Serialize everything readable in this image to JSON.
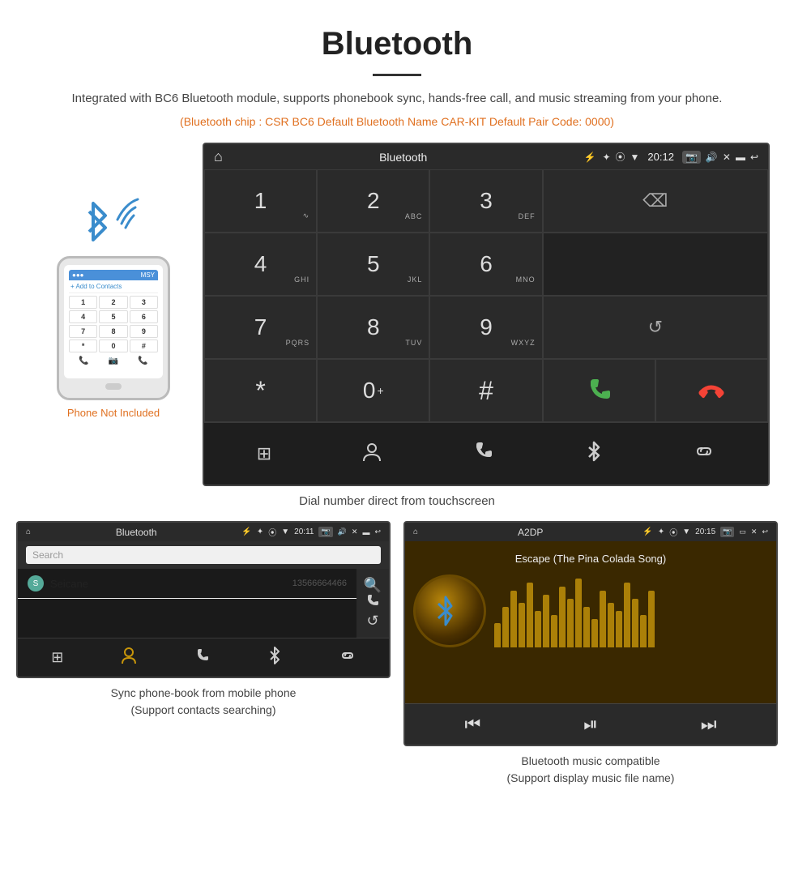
{
  "page": {
    "title": "Bluetooth",
    "subtitle": "Integrated with BC6 Bluetooth module, supports phonebook sync, hands-free call, and music streaming from your phone.",
    "specs": "(Bluetooth chip : CSR BC6    Default Bluetooth Name CAR-KIT    Default Pair Code: 0000)"
  },
  "main_screen": {
    "status_bar": {
      "home_icon": "⌂",
      "title": "Bluetooth",
      "usb_icon": "⚡",
      "bt_icon": "✦",
      "location_icon": "◉",
      "signal_icon": "▼",
      "time": "20:12",
      "camera_icon": "📷",
      "volume_icon": "🔊",
      "close_icon": "✕",
      "window_icon": "▬",
      "back_icon": "↩"
    },
    "dialpad": [
      {
        "key": "1",
        "sub": "∿",
        "row": 1,
        "col": 1
      },
      {
        "key": "2",
        "sub": "ABC",
        "row": 1,
        "col": 2
      },
      {
        "key": "3",
        "sub": "DEF",
        "row": 1,
        "col": 3
      },
      {
        "key": "⌫",
        "type": "backspace",
        "row": 1,
        "col": "4-5"
      },
      {
        "key": "4",
        "sub": "GHI",
        "row": 2,
        "col": 1
      },
      {
        "key": "5",
        "sub": "JKL",
        "row": 2,
        "col": 2
      },
      {
        "key": "6",
        "sub": "MNO",
        "row": 2,
        "col": 3
      },
      {
        "key": "",
        "type": "empty",
        "row": 2,
        "col": "4-5"
      },
      {
        "key": "7",
        "sub": "PQRS",
        "row": 3,
        "col": 1
      },
      {
        "key": "8",
        "sub": "TUV",
        "row": 3,
        "col": 2
      },
      {
        "key": "9",
        "sub": "WXYZ",
        "row": 3,
        "col": 3
      },
      {
        "key": "↺",
        "type": "reload",
        "row": 3,
        "col": "4-5"
      },
      {
        "key": "*",
        "row": 4,
        "col": 1
      },
      {
        "key": "0",
        "sub": "+",
        "row": 4,
        "col": 2
      },
      {
        "key": "#",
        "row": 4,
        "col": 3
      },
      {
        "key": "✆",
        "type": "call",
        "row": 4,
        "col": 4
      },
      {
        "key": "✆",
        "type": "hang",
        "row": 4,
        "col": 5
      }
    ],
    "action_bar": [
      {
        "icon": "⊞",
        "label": "dialpad"
      },
      {
        "icon": "👤",
        "label": "contacts"
      },
      {
        "icon": "✆",
        "label": "phone"
      },
      {
        "icon": "✦",
        "label": "bluetooth"
      },
      {
        "icon": "🔗",
        "label": "link"
      }
    ]
  },
  "dial_caption": "Dial number direct from touchscreen",
  "phone_label": "Phone Not Included",
  "contacts_screen": {
    "status_title": "Bluetooth",
    "time": "20:11",
    "search_placeholder": "Search",
    "contacts": [
      {
        "letter": "S",
        "name": "Seicane",
        "number": "13566664466"
      }
    ],
    "action_icons": [
      "🔍",
      "✆",
      "↺"
    ],
    "bottom_icons": [
      "⊞",
      "👤",
      "✆",
      "✦",
      "🔗"
    ]
  },
  "contacts_caption": {
    "line1": "Sync phone-book from mobile phone",
    "line2": "(Support contacts searching)"
  },
  "music_screen": {
    "status_title": "A2DP",
    "time": "20:15",
    "song_title": "Escape (The Pina Colada Song)",
    "viz_heights": [
      30,
      50,
      70,
      55,
      80,
      45,
      65,
      40,
      75,
      60,
      85,
      50,
      35,
      70,
      55,
      45,
      80,
      60,
      40,
      70
    ],
    "controls": [
      "⏮",
      "⏯",
      "⏭"
    ]
  },
  "music_caption": {
    "line1": "Bluetooth music compatible",
    "line2": "(Support display music file name)"
  }
}
